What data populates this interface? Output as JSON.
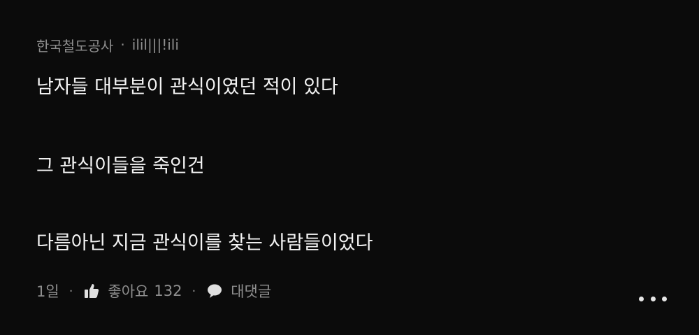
{
  "comment": {
    "author": "한국철도공사",
    "separator": "·",
    "handle": "ilil|||!ili",
    "lines": [
      "남자들 대부분이 관식이였던 적이 있다",
      "그 관식이들을 죽인건",
      "다름아닌 지금 관식이를 찾는 사람들이었다"
    ],
    "footer": {
      "time": "1일",
      "like_label": "좋아요",
      "like_count": "132",
      "reply_label": "대댓글",
      "sep": "·"
    }
  },
  "colors": {
    "background": "#0b0b0b",
    "text": "#f4f4f4",
    "muted": "#8e8e8e"
  },
  "icons": [
    "thumbs-up-icon",
    "chat-bubble-icon",
    "more-dots-icon"
  ]
}
